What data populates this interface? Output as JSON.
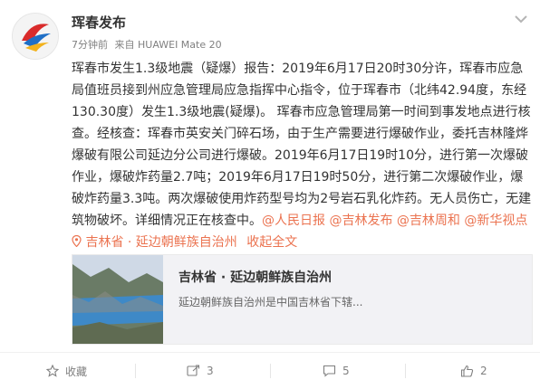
{
  "post": {
    "author": "珲春发布",
    "time": "7分钟前",
    "source": "来自 HUAWEI Mate 20",
    "text": {
      "p1": "珲春市发生1.3级地震（疑爆）报告：2019年6月17日20时30分许，珲春市应急局值班员接到州应急管理局应急指挥中心指令，位于珲春市（北纬42.94度，东经130.30度）发生1.3级地震(疑爆)。 珲春市应急管理局第一时间到事发地点进行核查。经核查：珲春市英安关门碎石场，由于生产需要进行爆破作业，委托吉林隆烨爆破有限公司延边分公司进行爆破。2019年6月17日19时10分，进行第一次爆破作业，爆破炸药量2.7吨；2019年6月17日19时50分，进行第二次爆破作业，爆破炸药量3.3吨。两次爆破使用炸药型号均为2号岩石乳化炸药。无人员伤亡，无建筑物破坏。详细情况正在核查中。",
      "mention1": "@人民日报",
      "mention2": "@吉林发布",
      "mention3": "@吉林周和",
      "mention4": "@新华视点",
      "location": "吉林省 · 延边朝鲜族自治州",
      "collapse": "收起全文"
    }
  },
  "card": {
    "title": "吉林省 · 延边朝鲜族自治州",
    "desc": "延边朝鲜族自治州是中国吉林省下辖..."
  },
  "actions": {
    "favorite_label": "收藏",
    "repost_count": "3",
    "comment_count": "5",
    "like_count": "2"
  },
  "colors": {
    "link": "#eb7350",
    "meta": "#808080",
    "card_bg": "#f2f2f5"
  },
  "icons": [
    "chevron-down-icon",
    "location-pin-icon",
    "star-icon",
    "repost-icon",
    "comment-icon",
    "thumbs-up-icon"
  ]
}
